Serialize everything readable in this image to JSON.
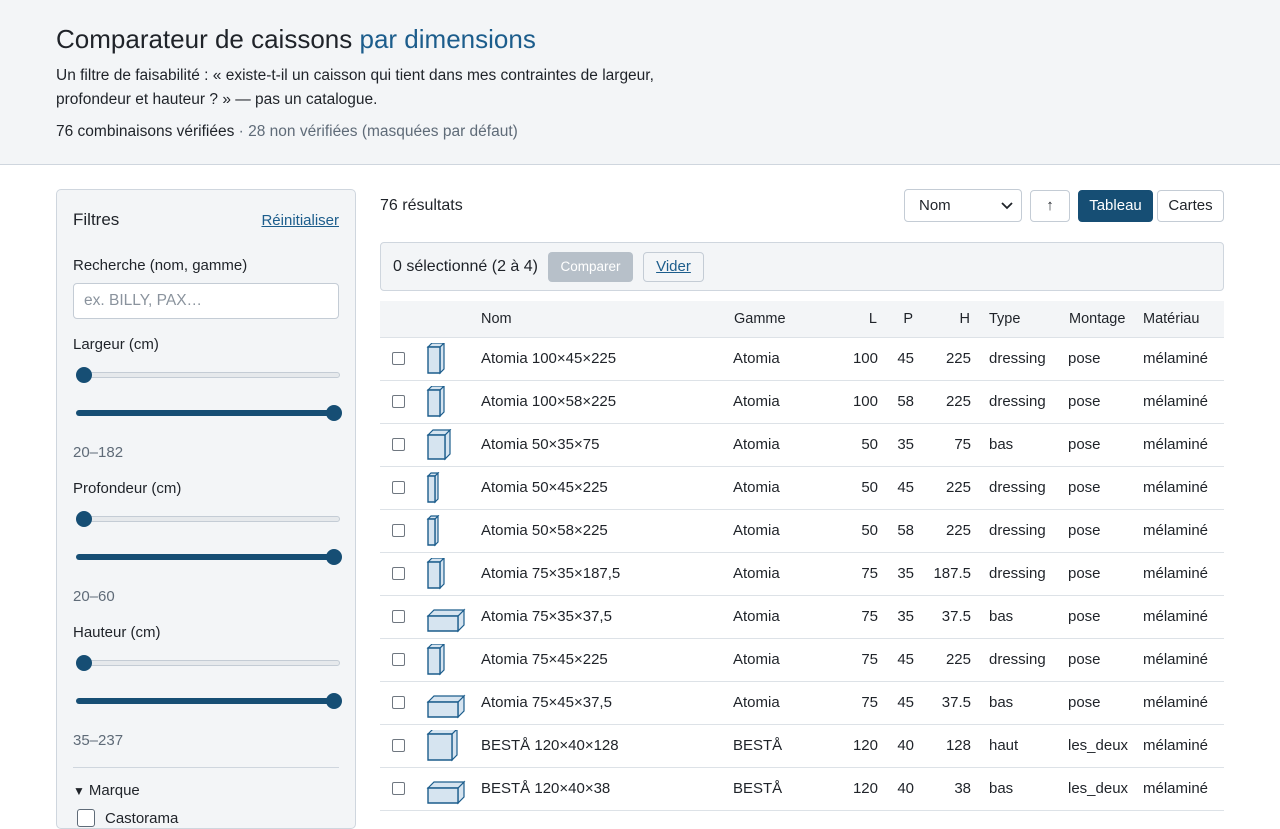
{
  "header": {
    "title_main": "Comparateur de caissons",
    "title_accent": "par dimensions",
    "subtitle": "Un filtre de faisabilité : « existe-t-il un caisson qui tient dans mes contraintes de largeur, profondeur et hauteur ? » — pas un catalogue.",
    "verified": "76 combinaisons vérifiées",
    "unverified": "· 28 non vérifiées (masquées par défaut)"
  },
  "filters": {
    "title": "Filtres",
    "reset_label": "Réinitialiser",
    "search_label": "Recherche (nom, gamme)",
    "search_placeholder": "ex. BILLY, PAX…",
    "search_value": "",
    "width_label": "Largeur (cm)",
    "width_range": "20–182",
    "width_min_fraction": 0,
    "width_max_fraction": 1,
    "depth_label": "Profondeur (cm)",
    "depth_range": "20–60",
    "height_label": "Hauteur (cm)",
    "height_range": "35–237",
    "brand_toggle": "Marque",
    "brands": [
      "Castorama"
    ]
  },
  "toolbar": {
    "result_count": "76 résultats",
    "sort_value": "Nom",
    "sort_dir": "↑",
    "view_table": "Tableau",
    "view_cards": "Cartes"
  },
  "compare": {
    "selection": "0 sélectionné (2 à 4)",
    "compare_label": "Comparer",
    "clear_label": "Vider"
  },
  "table": {
    "headers": {
      "name": "Nom",
      "range": "Gamme",
      "l": "L",
      "p": "P",
      "h": "H",
      "type": "Type",
      "mount": "Montage",
      "material": "Matériau"
    },
    "rows": [
      {
        "name": "Atomia 100×45×225",
        "range": "Atomia",
        "l": "100",
        "p": "45",
        "h": "225",
        "type": "dressing",
        "mount": "pose",
        "material": "mélaminé",
        "icon": "tall-cabinet-icon"
      },
      {
        "name": "Atomia 100×58×225",
        "range": "Atomia",
        "l": "100",
        "p": "58",
        "h": "225",
        "type": "dressing",
        "mount": "pose",
        "material": "mélaminé",
        "icon": "tall-cabinet-icon"
      },
      {
        "name": "Atomia 50×35×75",
        "range": "Atomia",
        "l": "50",
        "p": "35",
        "h": "75",
        "type": "bas",
        "mount": "pose",
        "material": "mélaminé",
        "icon": "base-cabinet-icon"
      },
      {
        "name": "Atomia 50×45×225",
        "range": "Atomia",
        "l": "50",
        "p": "45",
        "h": "225",
        "type": "dressing",
        "mount": "pose",
        "material": "mélaminé",
        "icon": "narrow-tall-cabinet-icon"
      },
      {
        "name": "Atomia 50×58×225",
        "range": "Atomia",
        "l": "50",
        "p": "58",
        "h": "225",
        "type": "dressing",
        "mount": "pose",
        "material": "mélaminé",
        "icon": "narrow-tall-cabinet-icon"
      },
      {
        "name": "Atomia 75×35×187,5",
        "range": "Atomia",
        "l": "75",
        "p": "35",
        "h": "187.5",
        "type": "dressing",
        "mount": "pose",
        "material": "mélaminé",
        "icon": "tall-cabinet-icon"
      },
      {
        "name": "Atomia 75×35×37,5",
        "range": "Atomia",
        "l": "75",
        "p": "35",
        "h": "37.5",
        "type": "bas",
        "mount": "pose",
        "material": "mélaminé",
        "icon": "flat-cabinet-icon"
      },
      {
        "name": "Atomia 75×45×225",
        "range": "Atomia",
        "l": "75",
        "p": "45",
        "h": "225",
        "type": "dressing",
        "mount": "pose",
        "material": "mélaminé",
        "icon": "tall-cabinet-icon"
      },
      {
        "name": "Atomia 75×45×37,5",
        "range": "Atomia",
        "l": "75",
        "p": "45",
        "h": "37.5",
        "type": "bas",
        "mount": "pose",
        "material": "mélaminé",
        "icon": "flat-cabinet-icon"
      },
      {
        "name": "BESTÅ 120×40×128",
        "range": "BESTÅ",
        "l": "120",
        "p": "40",
        "h": "128",
        "type": "haut",
        "mount": "les_deux",
        "material": "mélaminé",
        "icon": "square-cabinet-icon"
      },
      {
        "name": "BESTÅ 120×40×38",
        "range": "BESTÅ",
        "l": "120",
        "p": "40",
        "h": "38",
        "type": "bas",
        "mount": "les_deux",
        "material": "mélaminé",
        "icon": "flat-cabinet-icon"
      }
    ]
  },
  "colors": {
    "accent": "#1c5d8c",
    "primary": "#164e74",
    "panel_bg": "#f3f5f7",
    "cabinet_fill": "#d6e4f0",
    "cabinet_stroke": "#1c5d8c"
  }
}
